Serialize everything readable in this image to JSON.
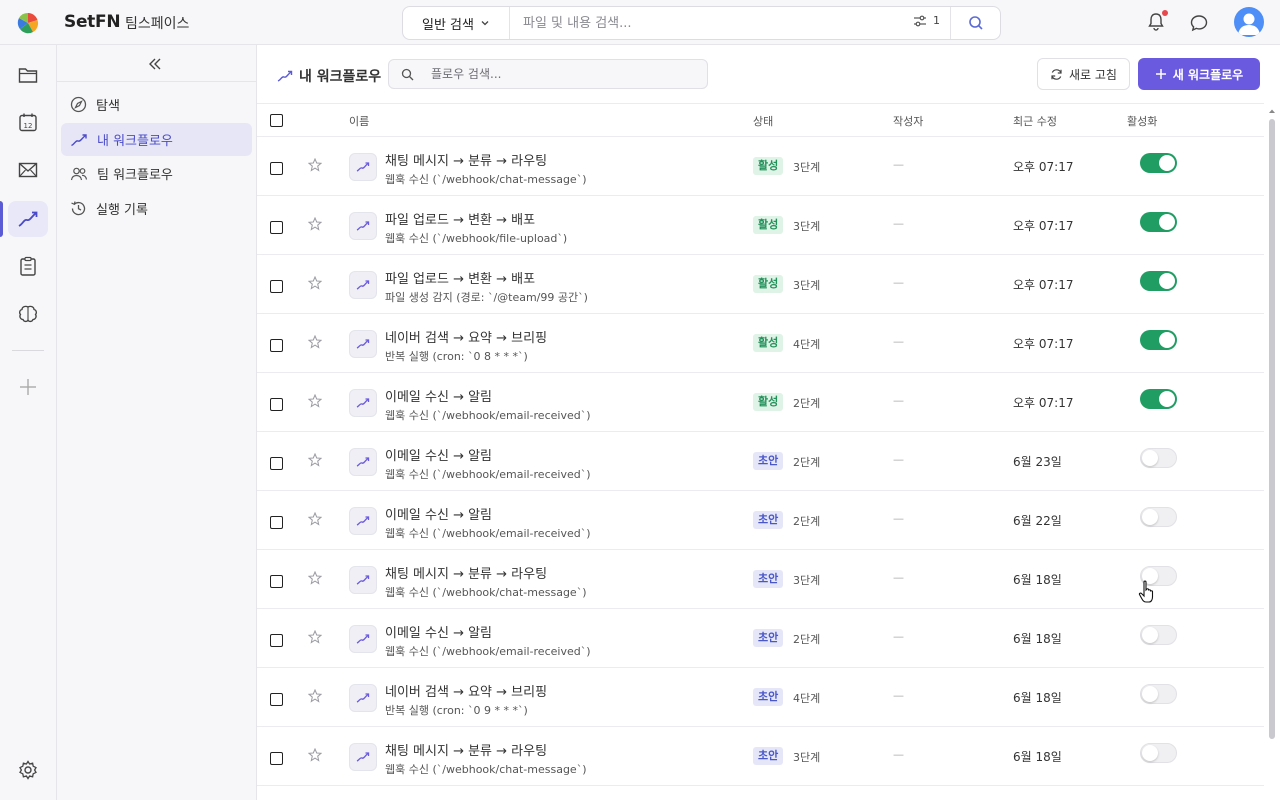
{
  "app": {
    "brand": "SetFN",
    "workspace": "팀스페이스"
  },
  "topbar": {
    "search_mode": "일반 검색",
    "search_placeholder": "파일 및 내용 검색...",
    "filter_count": "1"
  },
  "sidebar": {
    "items": [
      {
        "label": "탐색",
        "icon": "compass-icon"
      },
      {
        "label": "내 워크플로우",
        "icon": "workflow-icon"
      },
      {
        "label": "팀 워크플로우",
        "icon": "users-icon"
      },
      {
        "label": "실행 기록",
        "icon": "history-icon"
      }
    ]
  },
  "rail": {
    "icons": [
      "folder-icon",
      "calendar-icon",
      "mail-icon",
      "workflow-icon",
      "clipboard-icon",
      "brain-icon",
      "plus-icon",
      "settings-icon"
    ],
    "calendar_day": "12"
  },
  "main": {
    "title": "내 워크플로우",
    "search_placeholder": "플로우 검색...",
    "refresh_label": "새로 고침",
    "new_label": "새 워크플로우",
    "columns": {
      "name": "이름",
      "status": "상태",
      "author": "작성자",
      "modified": "최근 수정",
      "enabled": "활성화"
    },
    "rows": [
      {
        "title": "채팅 메시지 → 분류 → 라우팅",
        "trigger": "웹훅 수신 (`/webhook/chat-message`)",
        "status": "활성",
        "status_type": "active",
        "steps": "3단계",
        "author": "—",
        "modified": "오후 07:17",
        "enabled": true
      },
      {
        "title": "파일 업로드 → 변환 → 배포",
        "trigger": "웹훅 수신 (`/webhook/file-upload`)",
        "status": "활성",
        "status_type": "active",
        "steps": "3단계",
        "author": "—",
        "modified": "오후 07:17",
        "enabled": true
      },
      {
        "title": "파일 업로드 → 변환 → 배포",
        "trigger": "파일 생성 감지 (경로: `/@team/99 공간`)",
        "status": "활성",
        "status_type": "active",
        "steps": "3단계",
        "author": "—",
        "modified": "오후 07:17",
        "enabled": true
      },
      {
        "title": "네이버 검색 → 요약 → 브리핑",
        "trigger": "반복 실행 (cron: `0 8 * * *`)",
        "status": "활성",
        "status_type": "active",
        "steps": "4단계",
        "author": "—",
        "modified": "오후 07:17",
        "enabled": true
      },
      {
        "title": "이메일 수신 → 알림",
        "trigger": "웹훅 수신 (`/webhook/email-received`)",
        "status": "활성",
        "status_type": "active",
        "steps": "2단계",
        "author": "—",
        "modified": "오후 07:17",
        "enabled": true
      },
      {
        "title": "이메일 수신 → 알림",
        "trigger": "웹훅 수신 (`/webhook/email-received`)",
        "status": "초안",
        "status_type": "draft",
        "steps": "2단계",
        "author": "—",
        "modified": "6월 23일",
        "enabled": false
      },
      {
        "title": "이메일 수신 → 알림",
        "trigger": "웹훅 수신 (`/webhook/email-received`)",
        "status": "초안",
        "status_type": "draft",
        "steps": "2단계",
        "author": "—",
        "modified": "6월 22일",
        "enabled": false
      },
      {
        "title": "채팅 메시지 → 분류 → 라우팅",
        "trigger": "웹훅 수신 (`/webhook/chat-message`)",
        "status": "초안",
        "status_type": "draft",
        "steps": "3단계",
        "author": "—",
        "modified": "6월 18일",
        "enabled": false
      },
      {
        "title": "이메일 수신 → 알림",
        "trigger": "웹훅 수신 (`/webhook/email-received`)",
        "status": "초안",
        "status_type": "draft",
        "steps": "2단계",
        "author": "—",
        "modified": "6월 18일",
        "enabled": false
      },
      {
        "title": "네이버 검색 → 요약 → 브리핑",
        "trigger": "반복 실행 (cron: `0 9 * * *`)",
        "status": "초안",
        "status_type": "draft",
        "steps": "4단계",
        "author": "—",
        "modified": "6월 18일",
        "enabled": false
      },
      {
        "title": "채팅 메시지 → 분류 → 라우팅",
        "trigger": "웹훅 수신 (`/webhook/chat-message`)",
        "status": "초안",
        "status_type": "draft",
        "steps": "3단계",
        "author": "—",
        "modified": "6월 18일",
        "enabled": false
      }
    ]
  },
  "colors": {
    "accent": "#6a5ae0",
    "active_green": "#1f9d63",
    "draft_blue": "#4a57c9"
  }
}
